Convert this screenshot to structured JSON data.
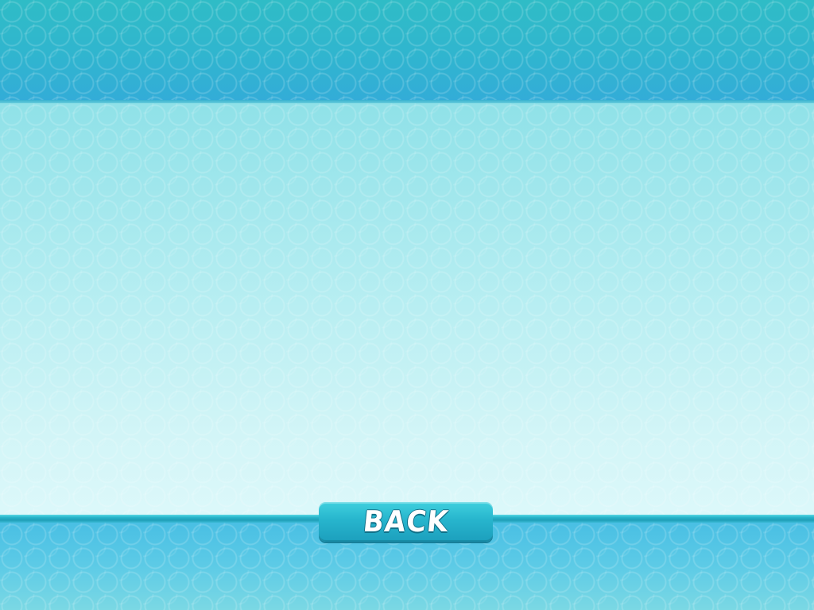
{
  "screen": {
    "back_button_label": "BACK"
  },
  "colors": {
    "top_band": "#30b5cf",
    "main_panel_top": "#8fe1e8",
    "main_panel_bottom": "#dcf8fa",
    "bottom_band": "#5dcbe6",
    "button": "#27b5cd",
    "button_text": "#ffffff"
  }
}
